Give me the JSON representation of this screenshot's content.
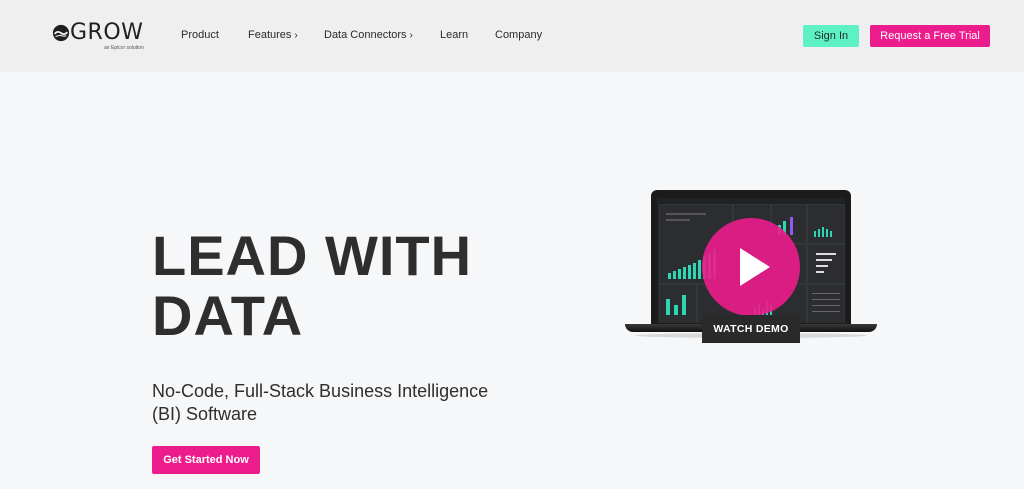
{
  "header": {
    "logo": {
      "wordmark": "GROW",
      "tagline": "an Epicor solution"
    },
    "nav": [
      {
        "label": "Product",
        "has_chevron": false
      },
      {
        "label": "Features",
        "has_chevron": true
      },
      {
        "label": "Data Connectors",
        "has_chevron": true
      },
      {
        "label": "Learn",
        "has_chevron": false
      },
      {
        "label": "Company",
        "has_chevron": false
      }
    ],
    "chevron_glyph": "›",
    "sign_in_label": "Sign In",
    "trial_label": "Request a Free Trial"
  },
  "hero": {
    "title_line1": "LEAD WITH",
    "title_line2": "DATA",
    "subtitle_line1": "No-Code, Full-Stack Business Intelligence",
    "subtitle_line2": "(BI) Software",
    "cta_label": "Get Started Now"
  },
  "demo": {
    "watch_label": "WATCH DEMO",
    "play_icon": "play-icon"
  },
  "colors": {
    "accent_pink": "#ec1c8c",
    "accent_mint": "#5ef1c3",
    "header_bg": "#efefef",
    "page_bg": "#f6f7f9"
  }
}
